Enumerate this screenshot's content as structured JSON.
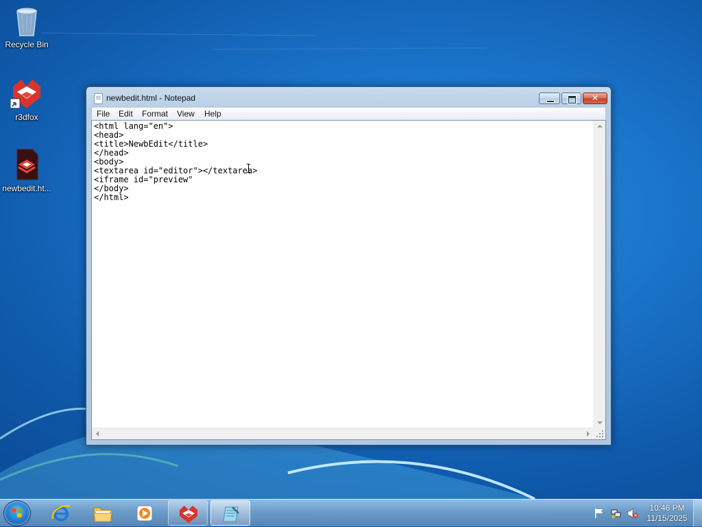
{
  "desktop": {
    "icons": [
      {
        "label": "Recycle Bin",
        "icon": "recycle-bin-icon"
      },
      {
        "label": "r3dfox",
        "icon": "r3dfox-shortcut-icon"
      },
      {
        "label": "newbedit.ht...",
        "icon": "html-file-icon"
      }
    ]
  },
  "window": {
    "title": "newbedit.html - Notepad",
    "menu": [
      "File",
      "Edit",
      "Format",
      "View",
      "Help"
    ],
    "content": "<html lang=\"en\">\n<head>\n<title>NewbEdit</title>\n</head>\n<body>\n<textarea id=\"editor\"></textarea>\n<iframe id=\"preview\"\n</body>\n</html>"
  },
  "taskbar": {
    "pinned": [
      {
        "name": "internet-explorer",
        "icon": "internet-explorer-icon"
      },
      {
        "name": "windows-explorer",
        "icon": "folder-icon"
      },
      {
        "name": "media-player",
        "icon": "media-player-icon"
      },
      {
        "name": "r3dfox",
        "icon": "r3dfox-icon"
      },
      {
        "name": "notepad",
        "icon": "notepad-icon"
      }
    ],
    "tray_icons": [
      "action-center-flag-icon",
      "network-icon",
      "volume-muted-icon"
    ],
    "clock": {
      "time": "10:46 PM",
      "date": "11/15/2025"
    }
  },
  "colors": {
    "desktop_blue": "#1a73c9",
    "r3dfox_red": "#d8342c",
    "close_red": "#c6402a"
  }
}
